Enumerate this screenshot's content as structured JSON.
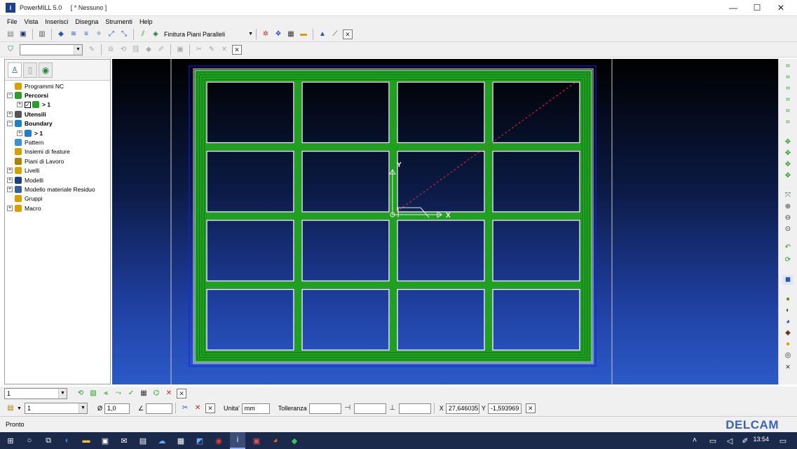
{
  "window": {
    "app_title": "PowerMILL 5.0",
    "project": "[ * Nessuno ]",
    "minimize": "—",
    "maximize": "☐",
    "close": "✕"
  },
  "menu": [
    "File",
    "Vista",
    "Inserisci",
    "Disegna",
    "Strumenti",
    "Help"
  ],
  "toolbar1": {
    "strategy_label": "Finitura Piani Paralleli"
  },
  "toolbar2": {
    "combo_value": ""
  },
  "tree": {
    "items": [
      {
        "label": "Programmi NC",
        "bold": false,
        "expander": "",
        "indent": 0,
        "icon": "nc-programs-icon",
        "color": "#d9a000"
      },
      {
        "label": "Percorsi",
        "bold": true,
        "expander": "−",
        "indent": 0,
        "icon": "toolpaths-icon",
        "color": "#2aa02a"
      },
      {
        "label": "> 1",
        "bold": true,
        "expander": "+",
        "indent": 1,
        "icon": "toolpath-item-icon",
        "color": "#2aa02a"
      },
      {
        "label": "Utensili",
        "bold": true,
        "expander": "+",
        "indent": 0,
        "icon": "tools-icon",
        "color": "#555555"
      },
      {
        "label": "Boundary",
        "bold": true,
        "expander": "−",
        "indent": 0,
        "icon": "boundary-icon",
        "color": "#1a7fd0"
      },
      {
        "label": "> 1",
        "bold": true,
        "expander": "+",
        "indent": 1,
        "icon": "boundary-item-icon",
        "color": "#1a7fd0"
      },
      {
        "label": "Pattern",
        "bold": false,
        "expander": "",
        "indent": 0,
        "icon": "pattern-icon",
        "color": "#3b8fd6"
      },
      {
        "label": "Insiemi di feature",
        "bold": false,
        "expander": "",
        "indent": 0,
        "icon": "feature-sets-icon",
        "color": "#d9a000"
      },
      {
        "label": "Piani di Lavoro",
        "bold": false,
        "expander": "",
        "indent": 0,
        "icon": "workplanes-icon",
        "color": "#b08000"
      },
      {
        "label": "Livelli",
        "bold": false,
        "expander": "+",
        "indent": 0,
        "icon": "levels-icon",
        "color": "#d9a000"
      },
      {
        "label": "Modelli",
        "bold": false,
        "expander": "+",
        "indent": 0,
        "icon": "models-icon",
        "color": "#1c3f8a"
      },
      {
        "label": "Modello materiale Residuo",
        "bold": false,
        "expander": "+",
        "indent": 0,
        "icon": "rest-material-icon",
        "color": "#3060a0"
      },
      {
        "label": "Gruppi",
        "bold": false,
        "expander": "",
        "indent": 0,
        "icon": "groups-icon",
        "color": "#d9a000"
      },
      {
        "label": "Macro",
        "bold": false,
        "expander": "+",
        "indent": 0,
        "icon": "macro-icon",
        "color": "#d9a000"
      }
    ]
  },
  "viewport": {
    "axis_x": "X",
    "axis_y": "Y",
    "grid_rows": 4,
    "grid_cols": 4,
    "toolpath_color": "#1fa01f",
    "block_outline_color": "#0000ff"
  },
  "bottom1": {
    "combo_value": "1"
  },
  "bottom2": {
    "combo_value": "1",
    "diameter_value": "1,0",
    "units_label": "Unita'",
    "units_value": "mm",
    "tolerance_label": "Tolleranza",
    "x_label": "X",
    "x_value": "27,646035",
    "y_label": "Y",
    "y_value": "-1,593969"
  },
  "status": {
    "text": "Pronto",
    "logo": "DELCAM"
  },
  "taskbar": {
    "time": "13:54"
  }
}
